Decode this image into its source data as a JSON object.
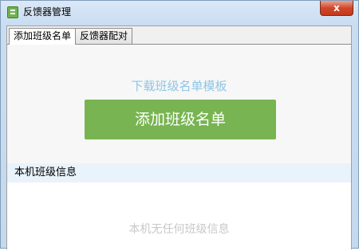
{
  "window": {
    "title": "反馈器管理",
    "close_symbol": "x",
    "icon": "app-icon"
  },
  "tabs": [
    {
      "label": "添加班级名单",
      "active": true
    },
    {
      "label": "反馈器配对",
      "active": false
    }
  ],
  "main": {
    "download_template_label": "下载班级名单模板",
    "add_class_list_label": "添加班级名单",
    "section_title": "本机班级信息",
    "empty_message": "本机无任何班级信息"
  },
  "colors": {
    "primary_button": "#78b451",
    "link": "#8ec5e6",
    "close_button": "#d1472a"
  }
}
